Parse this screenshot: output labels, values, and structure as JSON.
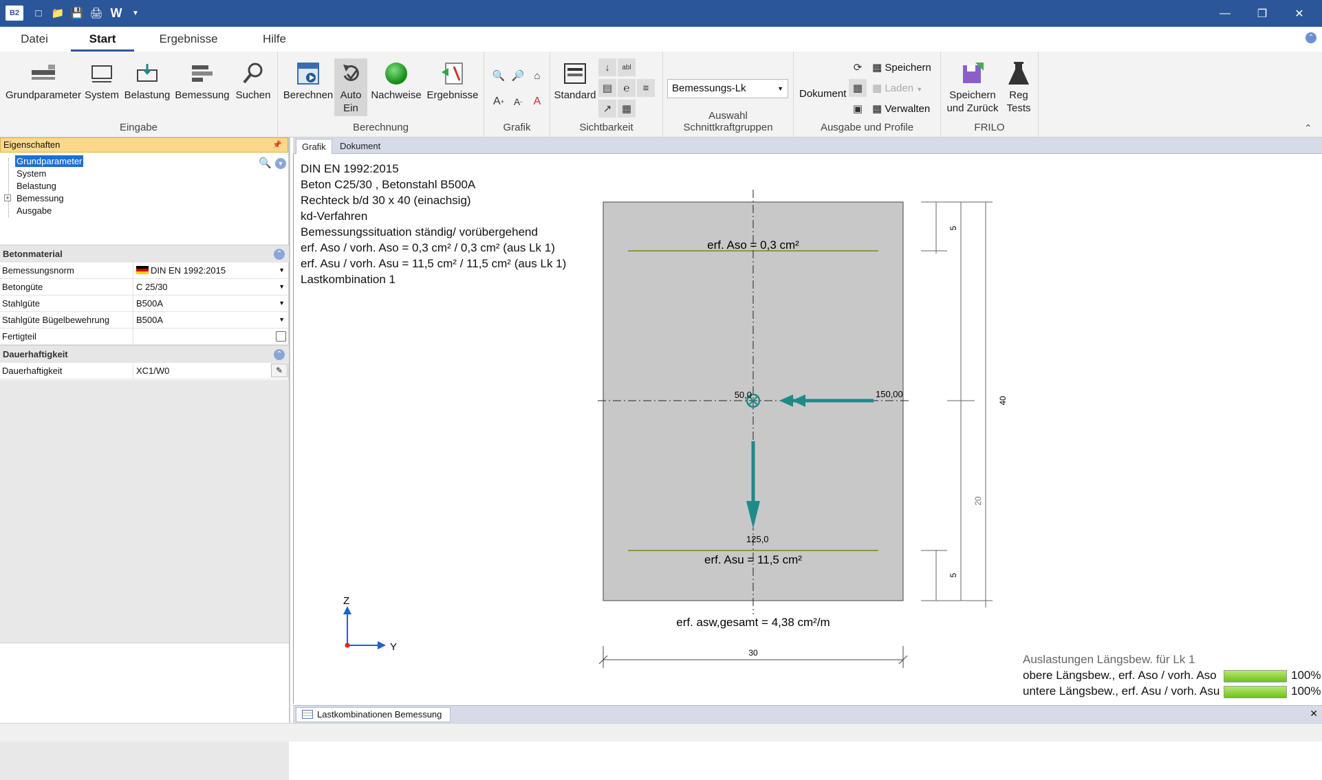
{
  "titlebar": {
    "app_badge": "B2",
    "word_icon": "W"
  },
  "menu": {
    "tabs": [
      "Datei",
      "Start",
      "Ergebnisse",
      "Hilfe"
    ],
    "active": "Start"
  },
  "ribbon": {
    "eingabe": {
      "label": "Eingabe",
      "buttons": [
        "Grundparameter",
        "System",
        "Belastung",
        "Bemessung",
        "Suchen"
      ]
    },
    "berechnung": {
      "label": "Berechnung",
      "berechnen": "Berechnen",
      "auto_line1": "Auto",
      "auto_line2": "Ein",
      "nachweise": "Nachweise",
      "ergebnisse": "Ergebnisse"
    },
    "grafik": {
      "label": "Grafik"
    },
    "sichtbarkeit": {
      "label": "Sichtbarkeit",
      "standard": "Standard"
    },
    "schnittkraft": {
      "label": "Auswahl Schnittkraftgruppen",
      "selected": "Bemessungs-Lk"
    },
    "ausgabe": {
      "label": "Ausgabe und Profile",
      "dokument": "Dokument",
      "speichern": "Speichern",
      "laden": "Laden",
      "verwalten": "Verwalten"
    },
    "frilo": {
      "label": "FRILO",
      "speichern_line1": "Speichern",
      "speichern_line2": "und Zurück",
      "reg_line1": "Reg",
      "reg_line2": "Tests"
    }
  },
  "left_panel": {
    "header": "Eigenschaften",
    "tree": [
      "Grundparameter",
      "System",
      "Belastung",
      "Bemessung",
      "Ausgabe"
    ],
    "selected_tree": "Grundparameter",
    "betonmaterial": {
      "title": "Betonmaterial",
      "rows": [
        {
          "label": "Bemessungsnorm",
          "value": "DIN EN 1992:2015"
        },
        {
          "label": "Betongüte",
          "value": "C 25/30"
        },
        {
          "label": "Stahlgüte",
          "value": "B500A"
        },
        {
          "label": "Stahlgüte Bügelbewehrung",
          "value": "B500A"
        },
        {
          "label": "Fertigteil",
          "value": ""
        }
      ]
    },
    "dauerhaftigkeit": {
      "title": "Dauerhaftigkeit",
      "rows": [
        {
          "label": "Dauerhaftigkeit",
          "value": "XC1/W0"
        }
      ]
    }
  },
  "doc_tabs": [
    "Grafik",
    "Dokument"
  ],
  "info_lines": [
    "DIN EN 1992:2015",
    "Beton C25/30 , Betonstahl B500A",
    "Rechteck b/d 30 x 40 (einachsig)",
    "kd-Verfahren",
    "Bemessungssituation ständig/ vorübergehend",
    "erf. Aso / vorh. Aso = 0,3 cm² / 0,3 cm² (aus Lk 1)",
    "erf. Asu / vorh. Asu = 11,5 cm² / 11,5 cm² (aus Lk 1)",
    "Lastkombination 1"
  ],
  "drawing": {
    "aso_label": "erf. Aso = 0,3 cm²",
    "asu_label": "erf. Asu = 11,5 cm²",
    "asw_label": "erf. asw,gesamt = 4,38 cm²/m",
    "moment_label": "50,0",
    "normal_label": "150,00",
    "shear_label": "125,0",
    "width_dim": "30",
    "dim_top": "5",
    "dim_bottom": "5",
    "dim_mid": "20",
    "dim_total": "40",
    "axis_z": "Z",
    "axis_y": "Y",
    "colors": {
      "section": "#c8c8c8",
      "rebar": "#8a9a3a",
      "force": "#1f8a8a"
    }
  },
  "utilization": {
    "title": "Auslastungen Längsbew. für Lk 1",
    "rows": [
      {
        "label": "obere Längsbew., erf. Aso / vorh. Aso",
        "percent": "100%",
        "fraction": 1.0
      },
      {
        "label": "untere Längsbew., erf. Asu / vorh. Asu",
        "percent": "100%",
        "fraction": 1.0
      }
    ]
  },
  "bottom_tab": "Lastkombinationen Bemessung"
}
